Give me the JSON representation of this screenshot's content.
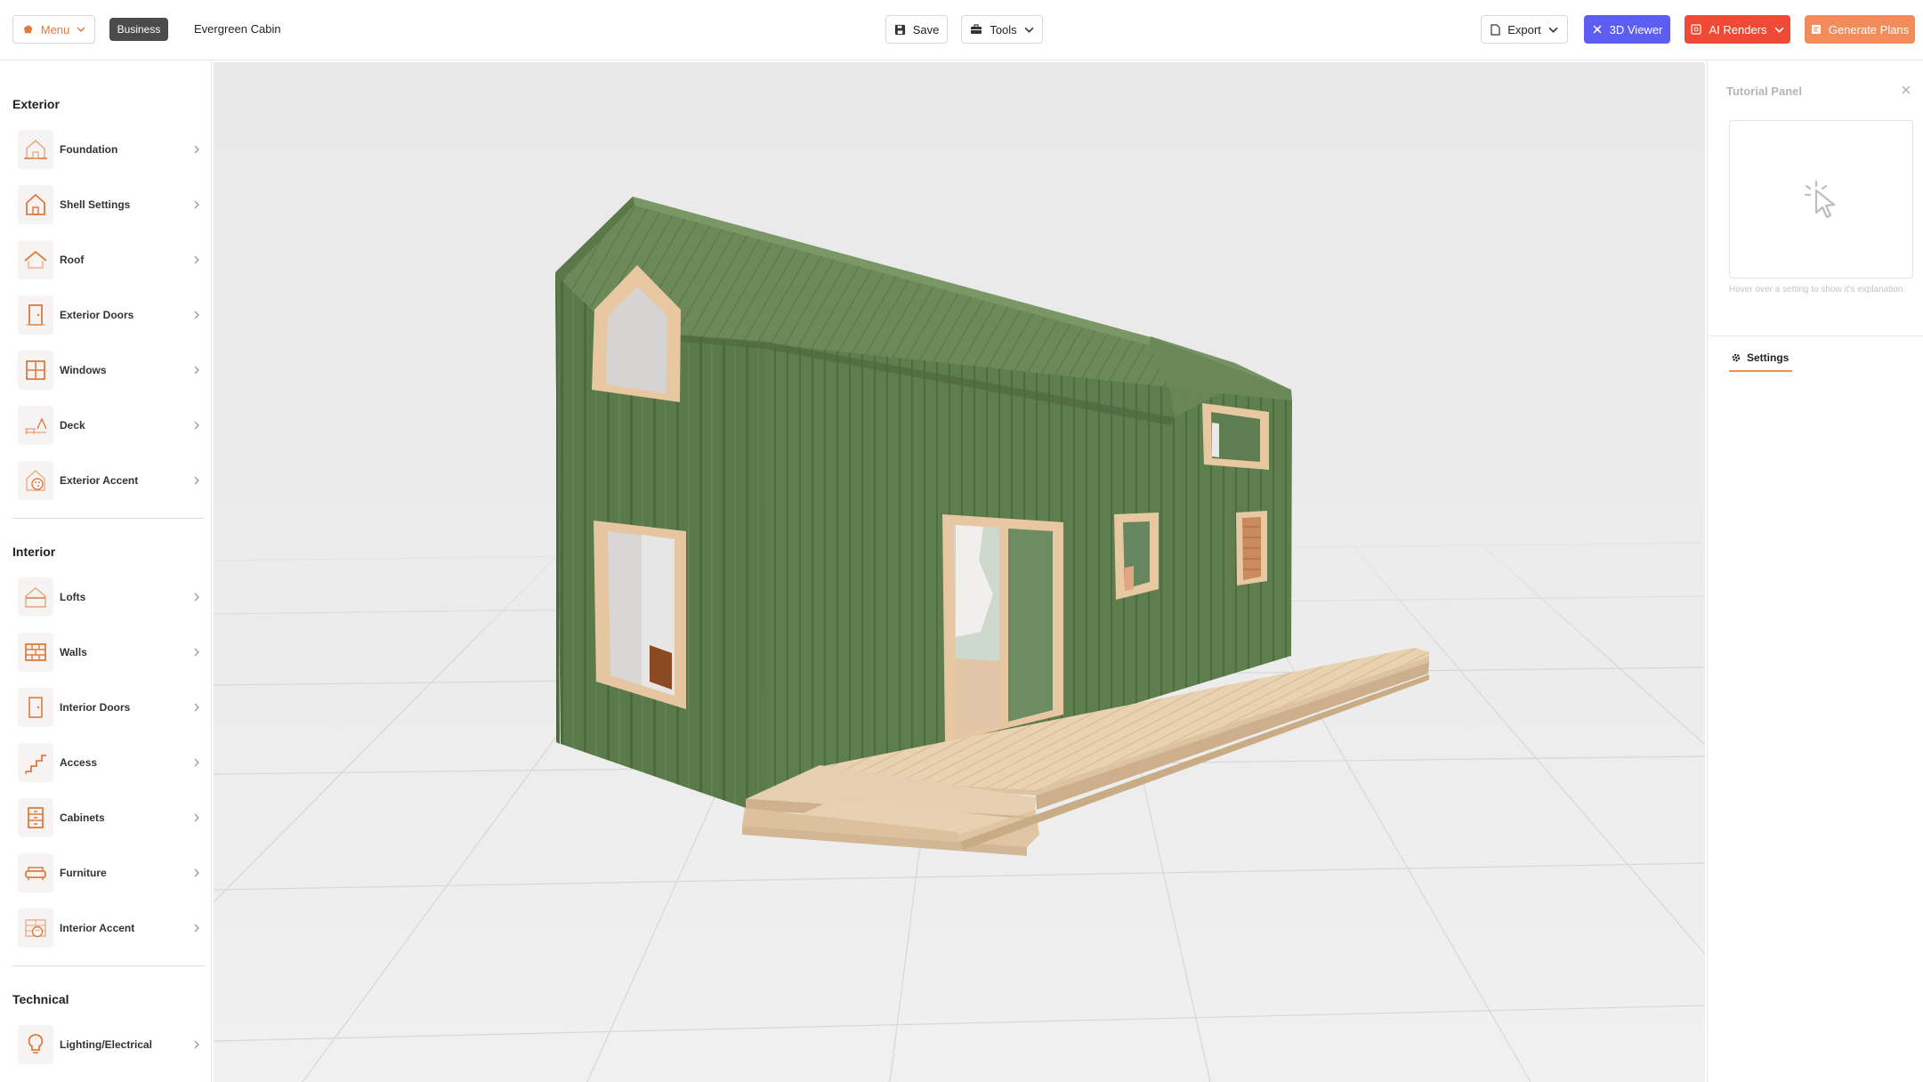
{
  "header": {
    "menu_label": "Menu",
    "badge": "Business",
    "project_name": "Evergreen Cabin",
    "save_label": "Save",
    "tools_label": "Tools",
    "export_label": "Export",
    "viewer_label": "3D Viewer",
    "renders_label": "AI Renders",
    "plans_label": "Generate Plans"
  },
  "sidebar": {
    "exterior_title": "Exterior",
    "exterior_items": [
      {
        "label": "Foundation",
        "icon": "foundation-icon"
      },
      {
        "label": "Shell Settings",
        "icon": "house-icon"
      },
      {
        "label": "Roof",
        "icon": "roof-icon"
      },
      {
        "label": "Exterior Doors",
        "icon": "door-icon"
      },
      {
        "label": "Windows",
        "icon": "window-icon"
      },
      {
        "label": "Deck",
        "icon": "deck-icon"
      },
      {
        "label": "Exterior Accent",
        "icon": "palette-icon"
      }
    ],
    "interior_title": "Interior",
    "interior_items": [
      {
        "label": "Lofts",
        "icon": "loft-icon"
      },
      {
        "label": "Walls",
        "icon": "brick-wall-icon"
      },
      {
        "label": "Interior Doors",
        "icon": "door-icon"
      },
      {
        "label": "Access",
        "icon": "stairs-icon"
      },
      {
        "label": "Cabinets",
        "icon": "cabinet-icon"
      },
      {
        "label": "Furniture",
        "icon": "sofa-icon"
      },
      {
        "label": "Interior Accent",
        "icon": "palette-icon"
      }
    ],
    "technical_title": "Technical",
    "technical_items": [
      {
        "label": "Lighting/Electrical",
        "icon": "lightbulb-icon"
      }
    ]
  },
  "tutorial": {
    "title": "Tutorial Panel",
    "hint": "Hover over a setting to show it's explanation.",
    "tab_label": "Settings"
  },
  "colors": {
    "accent": "#f28c5a",
    "icon_orange": "#e07a3f",
    "viewer_blue": "#5b5ef0",
    "renders_red": "#ee4a35",
    "cabin_green": "#5c7a4c",
    "wood": "#e6c9a5"
  }
}
